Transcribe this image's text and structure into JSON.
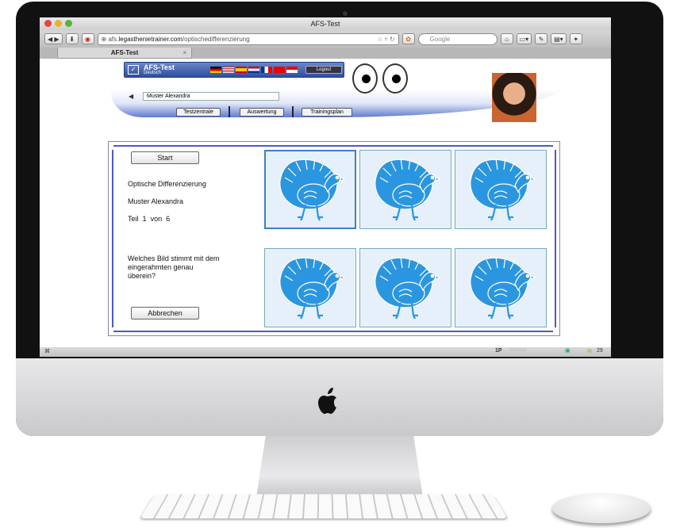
{
  "window": {
    "title": "AFS-Test"
  },
  "browser": {
    "url_prefix": "afs.",
    "url_domain": "legasthenietrainer.com",
    "url_path": "/optischedifferenzierung",
    "search_placeholder": "Google",
    "tab_label": "AFS-Test",
    "status_left": "⌘",
    "status_page": "1P",
    "status_count": "29"
  },
  "app": {
    "title": "AFS-Test",
    "subtitle": "Deutsch",
    "logout_label": "Logout",
    "user_name": "Muster Alexandra",
    "nav": [
      "Testzentrale",
      "Auswertung",
      "Trainingsplan"
    ]
  },
  "test": {
    "start_label": "Start",
    "task_title": "Optische Differenzierung",
    "student_name": "Muster Alexandra",
    "part_label": "Teil",
    "part_current": "1",
    "part_of": "von",
    "part_total": "6",
    "question": "Welches Bild stimmt mit dem eingerahmten genau überein?",
    "cancel_label": "Abbrechen"
  },
  "colors": {
    "accent_blue": "#3b7ec9",
    "turkey_blue": "#2b96e0",
    "panel_line": "#4b5bc6"
  },
  "icons": [
    "turkey-image",
    "apple-logo-icon",
    "back-icon",
    "forward-icon",
    "home-icon"
  ]
}
